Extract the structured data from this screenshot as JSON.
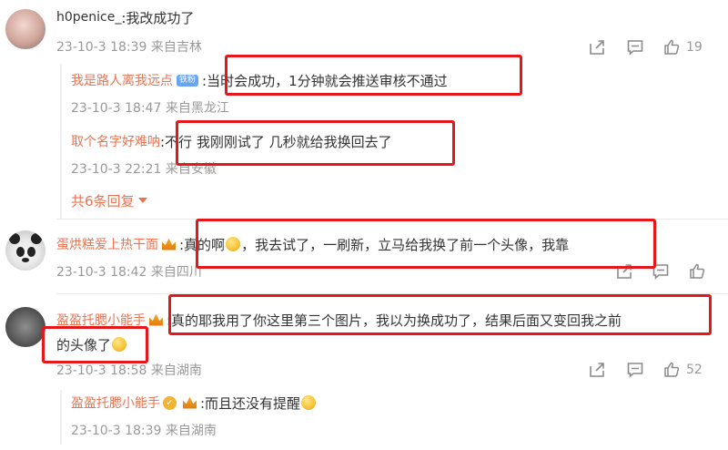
{
  "comments": [
    {
      "user": "h0penice_",
      "text": ":我改成功了",
      "time": "23-10-3 18:39 来自吉林",
      "likes": "19",
      "replies": [
        {
          "user": "我是路人离我远点",
          "badge": "铁粉",
          "text": ":当时会成功，1分钟就会推送审核不通过",
          "time": "23-10-3 18:47 来自黑龙江"
        },
        {
          "user": "取个名字好难呐",
          "text": ":不行 我刚刚试了 几秒就给我换回去了",
          "time": "23-10-3 22:21 来自安徽"
        }
      ],
      "more_replies": "共6条回复"
    },
    {
      "user": "蛋烘糕爱上热干面",
      "text_a": ":真的啊",
      "text_b": "，我去试了，一刷新，立马给我换了前一个头像，我靠",
      "time": "23-10-3 18:42 来自四川"
    },
    {
      "user": "盈盈托腮小能手",
      "text_line1": ":真的耶我用了你这里第三个图片，我以为换成功了，结果后面又变回我之前",
      "text_line2": "的头像了",
      "time": "23-10-3 18:58 来自湖南",
      "likes": "52",
      "replies": [
        {
          "user": "盈盈托腮小能手",
          "text": ":而且还没有提醒",
          "time": "23-10-3 18:39 来自湖南"
        }
      ]
    }
  ],
  "icons": [
    "share-icon",
    "comment-icon",
    "like-icon",
    "emoji-icon",
    "crown-icon",
    "vip-icon"
  ],
  "colors": {
    "username": "#eb7350",
    "text": "#333333",
    "meta": "#999999",
    "highlight_box": "#e5171b"
  }
}
